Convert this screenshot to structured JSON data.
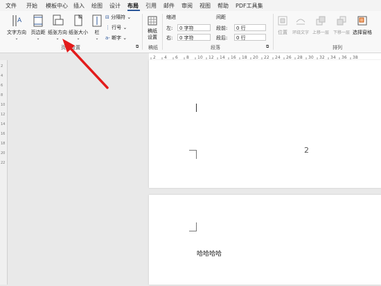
{
  "menu": {
    "tabs": [
      "文件",
      "开始",
      "模板中心",
      "插入",
      "绘图",
      "设计",
      "布局",
      "引用",
      "邮件",
      "审阅",
      "视图",
      "帮助",
      "PDF工具集"
    ],
    "active_index": 6,
    "accent": "#2b579a"
  },
  "ribbon": {
    "page_setup": {
      "buttons": [
        {
          "label": "文字方向",
          "icon": "text-direction-icon"
        },
        {
          "label": "页边距",
          "icon": "margins-icon"
        },
        {
          "label": "纸张方向",
          "icon": "orientation-icon"
        },
        {
          "label": "纸张大小",
          "icon": "size-icon"
        },
        {
          "label": "栏",
          "icon": "columns-icon"
        }
      ],
      "small_buttons": [
        "分隔符",
        "行号",
        "断字"
      ],
      "group_label": "页面设置"
    },
    "draft": {
      "label_line1": "稿纸",
      "label_line2": "设置",
      "group_label": "稿纸"
    },
    "paragraph": {
      "indent_header": "缩进",
      "spacing_header": "间距",
      "left_label": "左:",
      "left_value": "0 字符",
      "right_label": "右:",
      "right_value": "0 字符",
      "before_label": "段前:",
      "before_value": "0 行",
      "after_label": "段后:",
      "after_value": "0 行",
      "group_label": "段落"
    },
    "arrange": {
      "buttons": [
        "位置",
        "环绕文字",
        "上移一层",
        "下移一层",
        "选择窗格"
      ],
      "group_label": "排列"
    }
  },
  "ruler": {
    "numbers": [
      "2",
      "4",
      "6",
      "8",
      "10",
      "12",
      "14",
      "16",
      "18",
      "20",
      "22",
      "24",
      "26",
      "28",
      "30",
      "32",
      "34",
      "36",
      "38"
    ],
    "vertical_numbers": [
      "2",
      "4",
      "6",
      "8",
      "10",
      "12",
      "14",
      "16",
      "18",
      "20",
      "22"
    ]
  },
  "document": {
    "page_number": "2",
    "body_text": "哈哈哈哈"
  },
  "annotation": {
    "color": "#e21b1b"
  }
}
